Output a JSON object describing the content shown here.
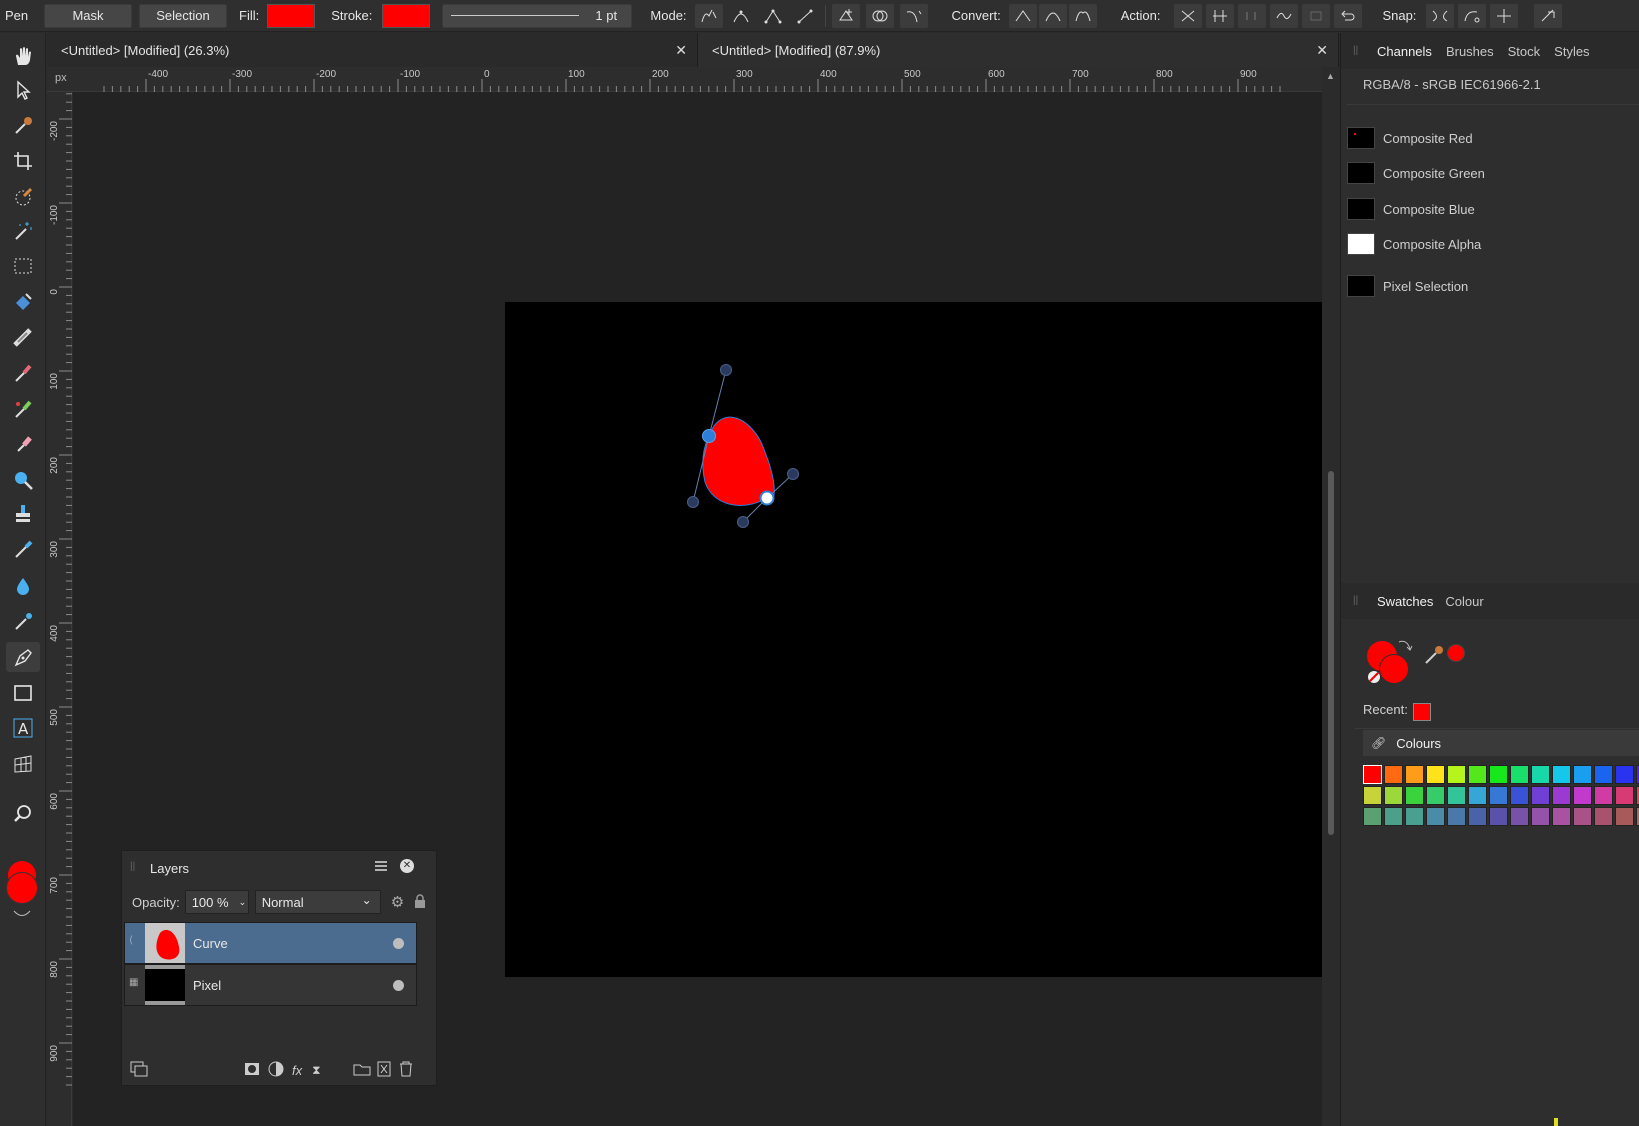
{
  "toolbar": {
    "tool_name": "Pen",
    "mask_label": "Mask",
    "selection_label": "Selection",
    "fill_label": "Fill:",
    "stroke_label": "Stroke:",
    "fill_color": "#ff0000",
    "stroke_color": "#ff0000",
    "stroke_width": "1 pt",
    "mode_label": "Mode:",
    "convert_label": "Convert:",
    "action_label": "Action:",
    "snap_label": "Snap:"
  },
  "tabs": [
    {
      "title": "<Untitled> [Modified] (26.3%)"
    },
    {
      "title": "<Untitled> [Modified] (87.9%)"
    }
  ],
  "ruler": {
    "unit": "px",
    "top_ticks": [
      "-400",
      "-300",
      "-200",
      "-100",
      "0",
      "100",
      "200",
      "300",
      "400",
      "500",
      "600",
      "700",
      "800",
      "900"
    ],
    "left_ticks": [
      "-200",
      "-100",
      "0",
      "100",
      "200",
      "300",
      "400",
      "500",
      "600",
      "700",
      "800",
      "900"
    ]
  },
  "layers_panel": {
    "title": "Layers",
    "opacity_label": "Opacity:",
    "opacity_value": "100 %",
    "blend_mode": "Normal",
    "layers": [
      {
        "name": "Curve",
        "selected": true
      },
      {
        "name": "Pixel",
        "selected": false
      }
    ]
  },
  "channels_panel": {
    "tabs": [
      "Channels",
      "Brushes",
      "Stock",
      "Styles"
    ],
    "active_tab": "Channels",
    "format": "RGBA/8 - sRGB IEC61966-2.1",
    "channels": [
      {
        "name": "Composite Red",
        "swatch": "#000000"
      },
      {
        "name": "Composite Green",
        "swatch": "#000000"
      },
      {
        "name": "Composite Blue",
        "swatch": "#000000"
      },
      {
        "name": "Composite Alpha",
        "swatch": "#ffffff"
      },
      {
        "name": "Pixel Selection",
        "swatch": "#000000"
      }
    ]
  },
  "swatches_panel": {
    "tabs": [
      "Swatches",
      "Colour"
    ],
    "active_tab": "Swatches",
    "recent_label": "Recent:",
    "recent_color": "#ff0000",
    "palette_name": "Colours",
    "palette_rows": [
      [
        "#ff0000",
        "#ff6a10",
        "#ff9c1a",
        "#ffe21a",
        "#b5f51c",
        "#52e81c",
        "#17e81c",
        "#19e06b",
        "#18d7a8",
        "#15c7e8",
        "#1a9ef0",
        "#1a64f0",
        "#2a34f0",
        "#5a1ff0"
      ],
      [
        "#c8d33a",
        "#9cd83a",
        "#3bd33d",
        "#36cc6a",
        "#33c49a",
        "#35a6d6",
        "#3778d6",
        "#3a52d6",
        "#7040d6",
        "#9a3ad0",
        "#c23acc",
        "#d23aa4",
        "#d83a74",
        "#d84a52"
      ],
      [
        "#5aa070",
        "#4ca08a",
        "#4aa090",
        "#4a8ca8",
        "#4a78a8",
        "#4a62a8",
        "#5a52a8",
        "#7852a8",
        "#9452a8",
        "#a852a0",
        "#a85288",
        "#a8526e",
        "#a85a5a",
        "#a86a5a"
      ]
    ]
  },
  "colors": {
    "fill_primary": "#ff0000",
    "accent_blue": "#2d7fd8",
    "layer_selected": "#4b6b8f"
  }
}
